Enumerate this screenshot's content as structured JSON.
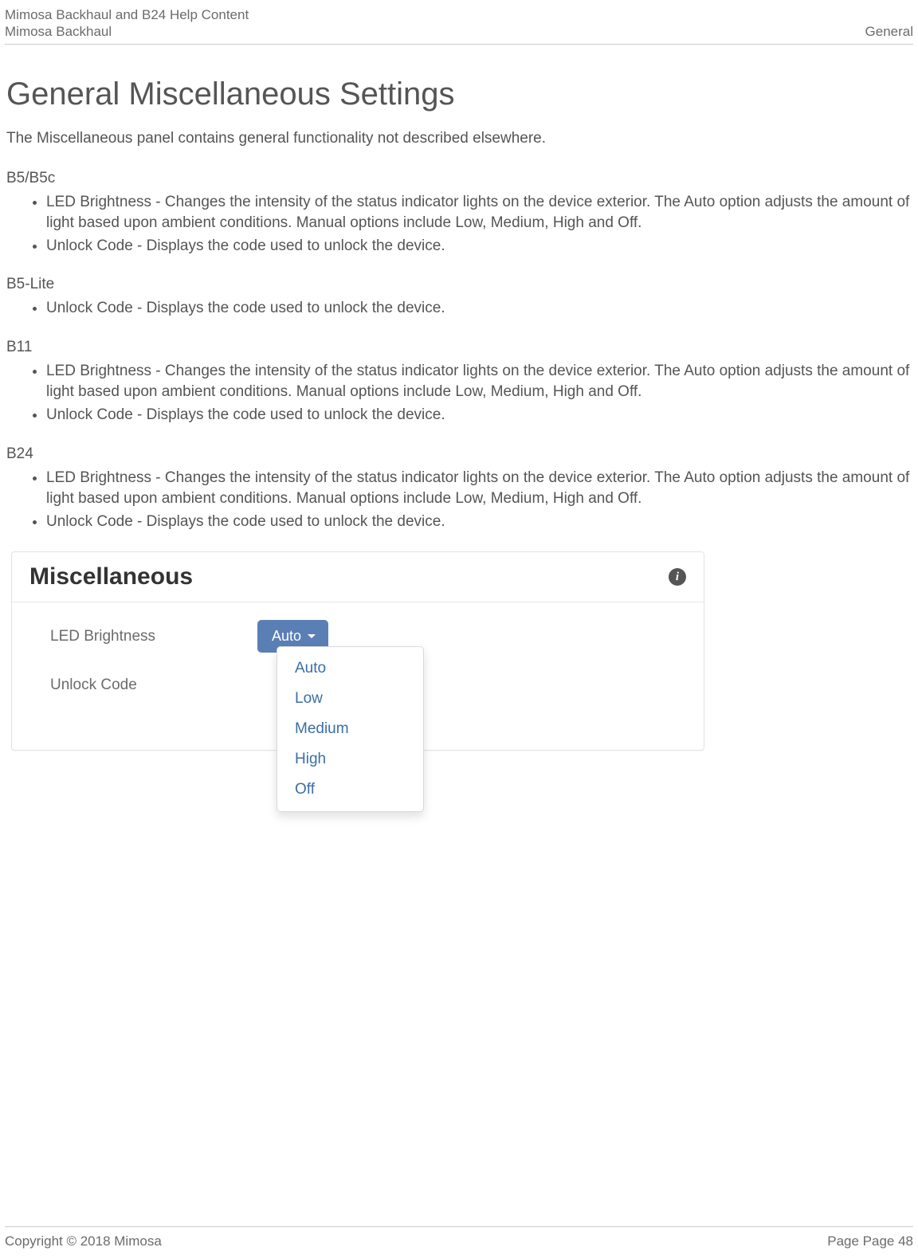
{
  "header": {
    "line1": "Mimosa Backhaul and B24 Help Content",
    "line2": "Mimosa Backhaul",
    "right": "General"
  },
  "page": {
    "title": "General Miscellaneous Settings",
    "intro": "The Miscellaneous panel contains general functionality not described elsewhere."
  },
  "sections": {
    "s0": {
      "label": "B5/B5c"
    },
    "s1": {
      "label": "B5-Lite"
    },
    "s2": {
      "label": "B11"
    },
    "s3": {
      "label": "B24"
    }
  },
  "bullets": {
    "led": "LED Brightness - Changes the intensity of the status indicator lights on the device exterior. The Auto option adjusts the amount of light based upon ambient conditions. Manual options include Low, Medium, High and Off.",
    "unlock": "Unlock Code - Displays the code used to unlock the device."
  },
  "panel": {
    "title": "Miscellaneous",
    "row0_label": "LED Brightness",
    "row1_label": "Unlock Code",
    "selected": "Auto",
    "options": {
      "o0": "Auto",
      "o1": "Low",
      "o2": "Medium",
      "o3": "High",
      "o4": "Off"
    }
  },
  "footer": {
    "left": "Copyright © 2018 Mimosa",
    "right": "Page Page 48"
  }
}
